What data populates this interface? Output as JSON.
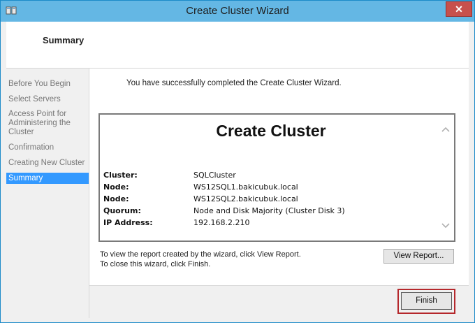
{
  "window": {
    "title": "Create Cluster Wizard",
    "close_glyph": "✕"
  },
  "header": {
    "title": "Summary"
  },
  "sidebar": {
    "items": [
      {
        "label": "Before You Begin",
        "active": false
      },
      {
        "label": "Select Servers",
        "active": false
      },
      {
        "label": "Access Point for Administering the Cluster",
        "active": false
      },
      {
        "label": "Confirmation",
        "active": false
      },
      {
        "label": "Creating New Cluster",
        "active": false
      },
      {
        "label": "Summary",
        "active": true
      }
    ]
  },
  "main": {
    "success_message": "You have successfully completed the Create Cluster Wizard.",
    "report": {
      "heading": "Create Cluster",
      "rows": [
        {
          "key": "Cluster:",
          "value": "SQLCluster"
        },
        {
          "key": "Node:",
          "value": "WS12SQL1.bakicubuk.local"
        },
        {
          "key": "Node:",
          "value": "WS12SQL2.bakicubuk.local"
        },
        {
          "key": "Quorum:",
          "value": "Node and Disk Majority (Cluster Disk 3)"
        },
        {
          "key": "IP Address:",
          "value": "192.168.2.210"
        }
      ]
    },
    "hint_line1": "To view the report created by the wizard, click View Report.",
    "hint_line2": "To close this wizard, click Finish.",
    "view_report_label": "View Report...",
    "finish_label": "Finish"
  },
  "icons": {
    "app": "cluster-app-icon",
    "scroll_up": "chevron-up-icon",
    "scroll_down": "chevron-down-icon"
  },
  "colors": {
    "titlebar": "#64b7e4",
    "close": "#c7504c",
    "active_nav": "#3399ff",
    "highlight": "#b5282c"
  }
}
